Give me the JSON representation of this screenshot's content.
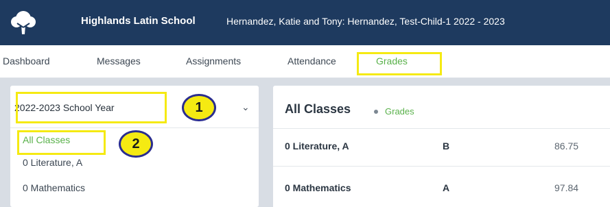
{
  "header": {
    "school_name": "Highlands Latin School",
    "family_title": "Hernandez, Katie and Tony: Hernandez, Test-Child-1 2022 - 2023"
  },
  "nav": {
    "items": [
      {
        "label": "Dashboard"
      },
      {
        "label": "Messages"
      },
      {
        "label": "Assignments"
      },
      {
        "label": "Attendance"
      },
      {
        "label": "Grades",
        "active": true
      }
    ]
  },
  "sidebar": {
    "year_select": "2022-2023 School Year",
    "classes": [
      {
        "label": "All Classes",
        "active": true
      },
      {
        "label": "0 Literature, A"
      },
      {
        "label": "0 Mathematics"
      }
    ]
  },
  "main": {
    "title": "All Classes",
    "breadcrumb": "Grades",
    "rows": [
      {
        "name": "0 Literature, A",
        "grade": "B",
        "score": "86.75"
      },
      {
        "name": "0 Mathematics",
        "grade": "A",
        "score": "97.84"
      }
    ]
  },
  "annotations": {
    "marker1": "1",
    "marker2": "2"
  },
  "colors": {
    "header_bg": "#1e3a5f",
    "accent_green": "#59b14a",
    "highlight_yellow": "#f5ea12",
    "marker_border": "#2a2d8f"
  },
  "icons": {
    "logo": "tree-logo-icon",
    "chevron": "chevron-down-icon"
  }
}
